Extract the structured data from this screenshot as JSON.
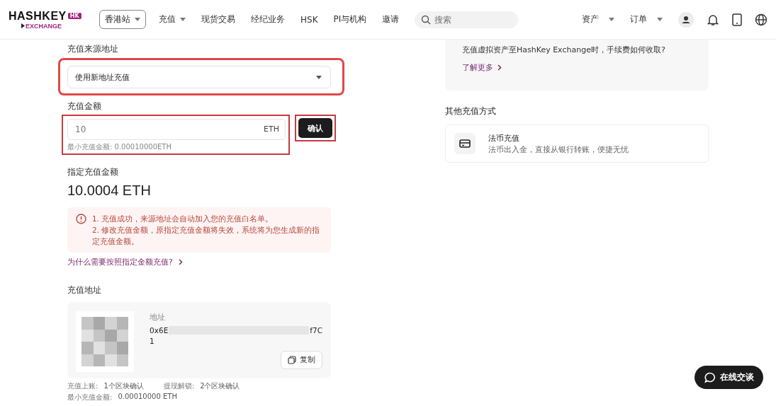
{
  "header": {
    "logo": {
      "wordmark": "HASHKEY",
      "badge": "HK",
      "sub": "EXCHANGE"
    },
    "region": "香港站",
    "nav": [
      {
        "label": "充值",
        "has_menu": true
      },
      {
        "label": "现货交易",
        "has_menu": false
      },
      {
        "label": "经纪业务",
        "has_menu": false
      },
      {
        "label": "HSK",
        "has_menu": false
      },
      {
        "label": "PI与机构",
        "has_menu": false
      },
      {
        "label": "邀请",
        "has_menu": false
      }
    ],
    "search": {
      "placeholder": "搜索"
    },
    "right_menus": [
      {
        "label": "资产"
      },
      {
        "label": "订单"
      }
    ]
  },
  "deposit": {
    "source_label": "充值来源地址",
    "source_value": "使用新地址充值",
    "amount_label": "充值金额",
    "amount_value": "10",
    "amount_unit": "ETH",
    "amount_hint": "最小充值金额: 0.00010000ETH",
    "confirm": "确认",
    "specified_label": "指定充值金额",
    "specified_value": "10.0004 ETH",
    "notices": [
      "1. 充值成功，来源地址会自动加入您的充值白名单。",
      "2. 修改充值金额，原指定充值金额将失效，系统将为您生成新的指定充值金额。"
    ],
    "why_link": "为什么需要按照指定金额充值?",
    "address_title": "充值地址",
    "address_label": "地址",
    "address_start": "0x6E",
    "address_end": "f7C",
    "address_line2": "1",
    "copy": "复制",
    "facts": [
      {
        "label": "充值上账:",
        "value": "1个区块确认"
      },
      {
        "label": "提现解锁:",
        "value": "2个区块确认"
      }
    ],
    "min_fact": {
      "label": "最小充值金额:",
      "value": "0.00010000 ETH"
    }
  },
  "side": {
    "faq_question": "充值虚拟资产至HashKey Exchange时，手续费如何收取?",
    "faq_link": "了解更多",
    "other_title": "其他充值方式",
    "methods": [
      {
        "title": "法币充值",
        "desc": "法币出入金，直接从银行转账，便捷无忧"
      }
    ]
  },
  "chat": "在线交谈"
}
